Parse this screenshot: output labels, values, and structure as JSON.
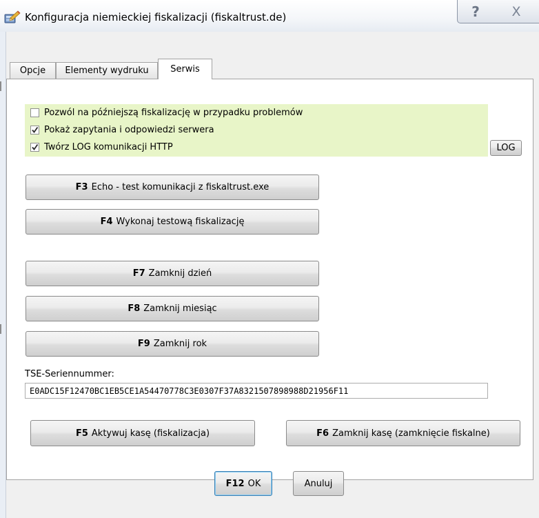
{
  "window": {
    "title": "Konfiguracja niemieckiej fiskalizacji (fiskaltrust.de)",
    "help_glyph": "?",
    "close_glyph": "X"
  },
  "tabs": [
    {
      "label": "Opcje"
    },
    {
      "label": "Elementy wydruku"
    },
    {
      "label": "Serwis",
      "active": true
    }
  ],
  "options": [
    {
      "label": "Pozwól na późniejszą fiskalizację w przypadku problemów",
      "checked": false
    },
    {
      "label": "Pokaż zapytania i odpowiedzi serwera",
      "checked": true
    },
    {
      "label": "Twórz LOG komunikacji HTTP",
      "checked": true
    }
  ],
  "log_button": "LOG",
  "service_buttons": [
    {
      "key": "F3",
      "label": "Echo - test komunikacji z fiskaltrust.exe"
    },
    {
      "key": "F4",
      "label": "Wykonaj testową fiskalizację"
    },
    {
      "key": "F7",
      "label": "Zamknij dzień"
    },
    {
      "key": "F8",
      "label": "Zamknij miesiąc"
    },
    {
      "key": "F9",
      "label": "Zamknij rok"
    }
  ],
  "tse": {
    "label": "TSE-Seriennummer:",
    "value": "E0ADC15F12470BC1EB5CE1A54470778C3E0307F37A8321507898988D21956F11"
  },
  "cash_buttons": [
    {
      "key": "F5",
      "label": "Aktywuj kasę (fiskalizacja)"
    },
    {
      "key": "F6",
      "label": "Zamknij kasę (zamknięcie fiskalne)"
    }
  ],
  "footer": {
    "ok_key": "F12",
    "ok_label": "OK",
    "cancel_label": "Anuluj"
  },
  "colors": {
    "highlight_bg": "#e8f5c8",
    "panel_bg": "#ffffff",
    "dialog_bg": "#f0f0f0"
  },
  "icons": {
    "app": "pencil-edit-icon",
    "help": "help-icon",
    "close": "close-icon",
    "checkbox": "checkmark-icon"
  }
}
